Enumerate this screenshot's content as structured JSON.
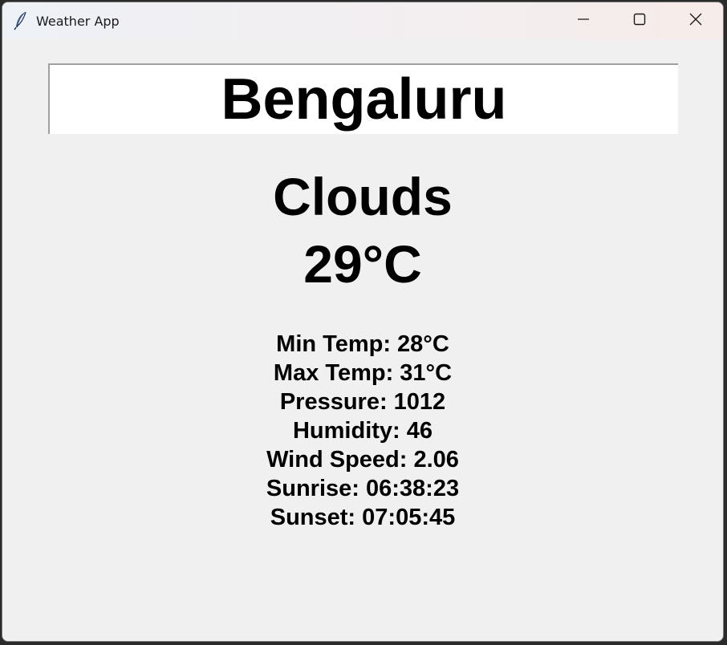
{
  "window": {
    "title": "Weather App"
  },
  "search": {
    "value": "Bengaluru"
  },
  "weather": {
    "condition": "Clouds",
    "temperature": "29°C"
  },
  "details": [
    "Min Temp: 28°C",
    "Max Temp: 31°C",
    "Pressure: 1012",
    "Humidity: 46",
    "Wind Speed: 2.06",
    "Sunrise: 06:38:23",
    "Sunset: 07:05:45"
  ],
  "icons": {
    "app": "feather-icon",
    "minimize": "minimize-icon",
    "maximize": "maximize-icon",
    "close": "close-icon"
  }
}
